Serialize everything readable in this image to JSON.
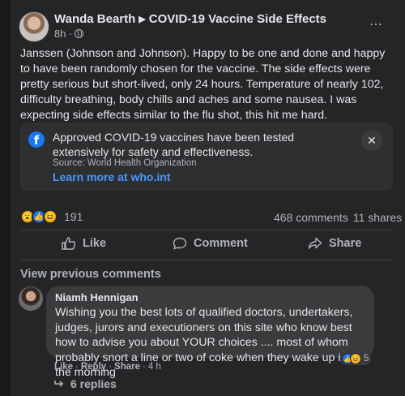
{
  "post": {
    "author": "Wanda Bearth",
    "group": "COVID-19 Vaccine Side Effects",
    "time": "8h",
    "dot": "·",
    "text": "Janssen (Johnson and Johnson). Happy to be one and done and happy to have been randomly chosen for the vaccine. The side effects were pretty serious but short-lived, only 24 hours. Temperature of nearly 102, difficulty breathing, body chills and aches and some nausea. I was expecting side effects similar to the flu shot, this hit me hard.",
    "more_icon": "⋯"
  },
  "info_box": {
    "text": "Approved COVID-19 vaccines have been tested extensively for safety and effectiveness.",
    "source": "Source: World Health Organization",
    "link": "Learn more at who.int",
    "close": "✕"
  },
  "stats": {
    "reaction_count": "191",
    "comments": "468 comments",
    "shares": "11 shares"
  },
  "actions": {
    "like": "Like",
    "comment": "Comment",
    "share": "Share"
  },
  "comments": {
    "view_previous": "View previous comments",
    "items": [
      {
        "name": "Niamh Hennigan",
        "text": "Wishing you the best lots of qualified doctors, undertakers, judges, jurors and executioners on this site who know best how to advise you about YOUR choices .... most of whom probably snort a line or two of coke when they wake up in the morning",
        "reaction_count": "5",
        "like": "Like",
        "reply": "Reply",
        "share": "Share",
        "time": "4 h",
        "dot": "·",
        "replies": "6 replies"
      }
    ]
  },
  "colors": {
    "background": "#242526",
    "link": "#4599ff",
    "brand": "#1877f2"
  }
}
